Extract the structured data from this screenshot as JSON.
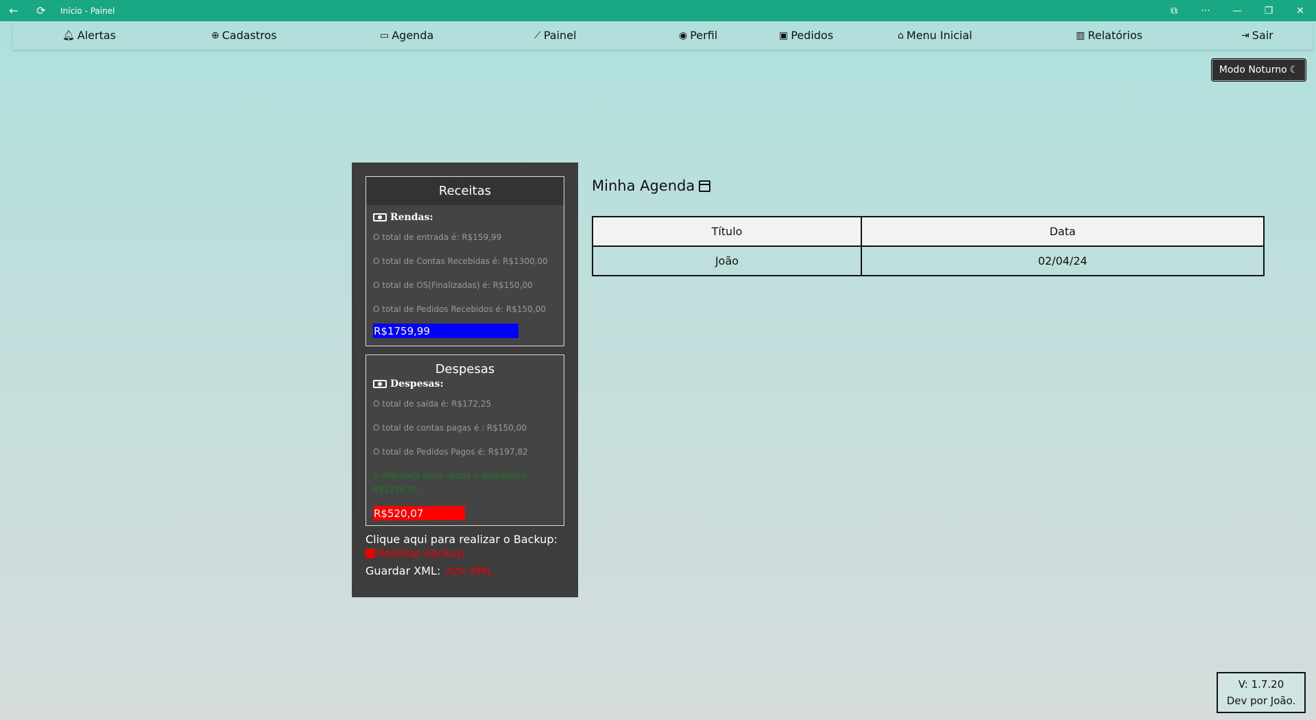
{
  "window": {
    "title": "Início - Painel",
    "controls": {
      "back": "←",
      "refresh": "⟳",
      "cast": "⧉",
      "more": "···",
      "minimize": "—",
      "restore": "❐",
      "close": "✕"
    }
  },
  "nav": {
    "items": [
      {
        "label": "Alertas",
        "icon": "bell-icon"
      },
      {
        "label": "Cadastros",
        "icon": "plus-circle-icon"
      },
      {
        "label": "Agenda",
        "icon": "calendar-icon"
      },
      {
        "label": "Painel",
        "icon": "chart-line-icon"
      },
      {
        "label": "Perfil",
        "icon": "user-circle-icon"
      },
      {
        "label": "Pedidos",
        "icon": "money-bill-icon"
      },
      {
        "label": "Menu Inicial",
        "icon": "home-icon"
      },
      {
        "label": "Relatórios",
        "icon": "bar-chart-icon"
      },
      {
        "label": "Sair",
        "icon": "sign-out-icon"
      }
    ]
  },
  "night_mode": {
    "label": "Modo Noturno",
    "icon": "moon-icon"
  },
  "receitas": {
    "title": "Receitas",
    "subtitle": "Rendas:",
    "lines": [
      "O total de entrada é: R$159,99",
      "O total de Contas Recebidas é: R$1300,00",
      "O total de OS(Finalizadas) é: R$150,00",
      "O total de Pedidos Recebidos é: R$150,00"
    ],
    "total": "R$1759,99",
    "total_color": "#0000ff"
  },
  "despesas": {
    "title": "Despesas",
    "subtitle": "Despesas:",
    "lines": [
      "O total de saída é: R$172,25",
      "O total de contas pagas é : R$150,00",
      "O total de Pedidos Pagos é: R$197,82"
    ],
    "difference": "A diferença entre renda e despesas é: R$1239,92",
    "total": "R$520,07",
    "total_color": "#ff0000"
  },
  "backup": {
    "prompt": "Clique aqui para realizar o Backup:",
    "link": "Realizar backup.",
    "xml_label": "Guardar XML:",
    "xml_link": "XML."
  },
  "agenda": {
    "title": "Minha Agenda",
    "columns": [
      "Título",
      "Data"
    ],
    "rows": [
      [
        "João",
        "02/04/24"
      ]
    ]
  },
  "version": {
    "line1": "V: 1.7.20",
    "line2": "Dev por João."
  }
}
